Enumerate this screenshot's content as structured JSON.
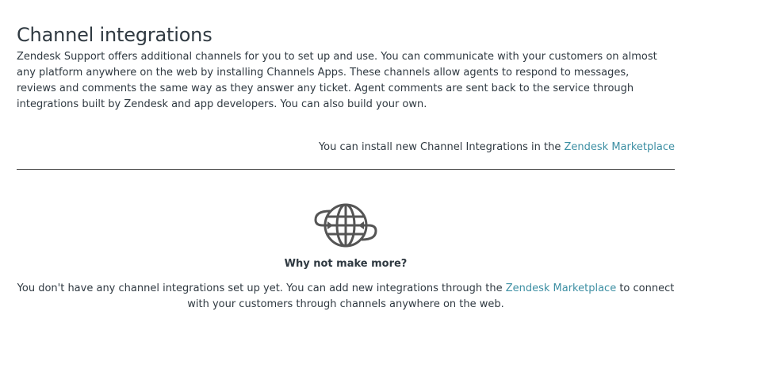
{
  "header": {
    "title": "Channel integrations",
    "description": "Zendesk Support offers additional channels for you to set up and use. You can communicate with your customers on almost any platform anywhere on the web by installing Channels Apps. These channels allow agents to respond to messages, reviews and comments the same way as they answer any ticket. Agent comments are sent back to the service through integrations built by Zendesk and app developers. You can also build your own."
  },
  "install": {
    "text": "You can install new Channel Integrations in the ",
    "link_label": "Zendesk Marketplace"
  },
  "empty_state": {
    "icon": "globe-arrows-icon",
    "heading": "Why not make more?",
    "text_before": "You don't have any channel integrations set up yet. You can add new integrations through the ",
    "link_label": "Zendesk Marketplace",
    "text_after": " to connect with your customers through channels anywhere on the web."
  },
  "colors": {
    "text": "#2f3941",
    "link": "#3d8fa3",
    "icon": "#555555",
    "divider": "#555555"
  }
}
